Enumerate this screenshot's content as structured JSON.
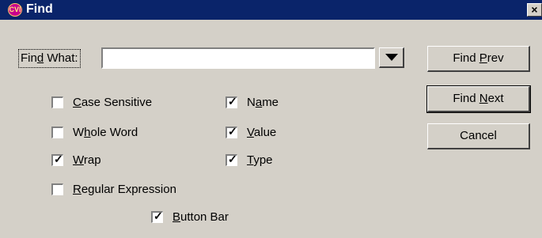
{
  "window": {
    "title": "Find",
    "icon": "cvi-app-icon",
    "icon_text": "CVI",
    "close_glyph": "×"
  },
  "find_what": {
    "label_before": "Fin",
    "label_accel": "d",
    "label_after": " What:",
    "value": ""
  },
  "dropdown": {
    "icon": "chevron-down-icon"
  },
  "buttons": {
    "find_prev": {
      "before": "Find ",
      "accel": "P",
      "after": "rev"
    },
    "find_next": {
      "before": "Find ",
      "accel": "N",
      "after": "ext"
    },
    "cancel": {
      "label": "Cancel"
    }
  },
  "options": {
    "case_sensitive": {
      "before": "",
      "accel": "C",
      "after": "ase Sensitive",
      "checked": false
    },
    "whole_word": {
      "before": "W",
      "accel": "h",
      "after": "ole Word",
      "checked": false
    },
    "wrap": {
      "before": "",
      "accel": "W",
      "after": "rap",
      "checked": true
    },
    "regular_expression": {
      "before": "",
      "accel": "R",
      "after": "egular Expression",
      "checked": false
    },
    "name": {
      "before": "N",
      "accel": "a",
      "after": "me",
      "checked": true
    },
    "value": {
      "before": "",
      "accel": "V",
      "after": "alue",
      "checked": true
    },
    "type": {
      "before": "",
      "accel": "T",
      "after": "ype",
      "checked": true
    },
    "button_bar": {
      "before": "",
      "accel": "B",
      "after": "utton Bar",
      "checked": true
    }
  },
  "check_glyph": "✓"
}
